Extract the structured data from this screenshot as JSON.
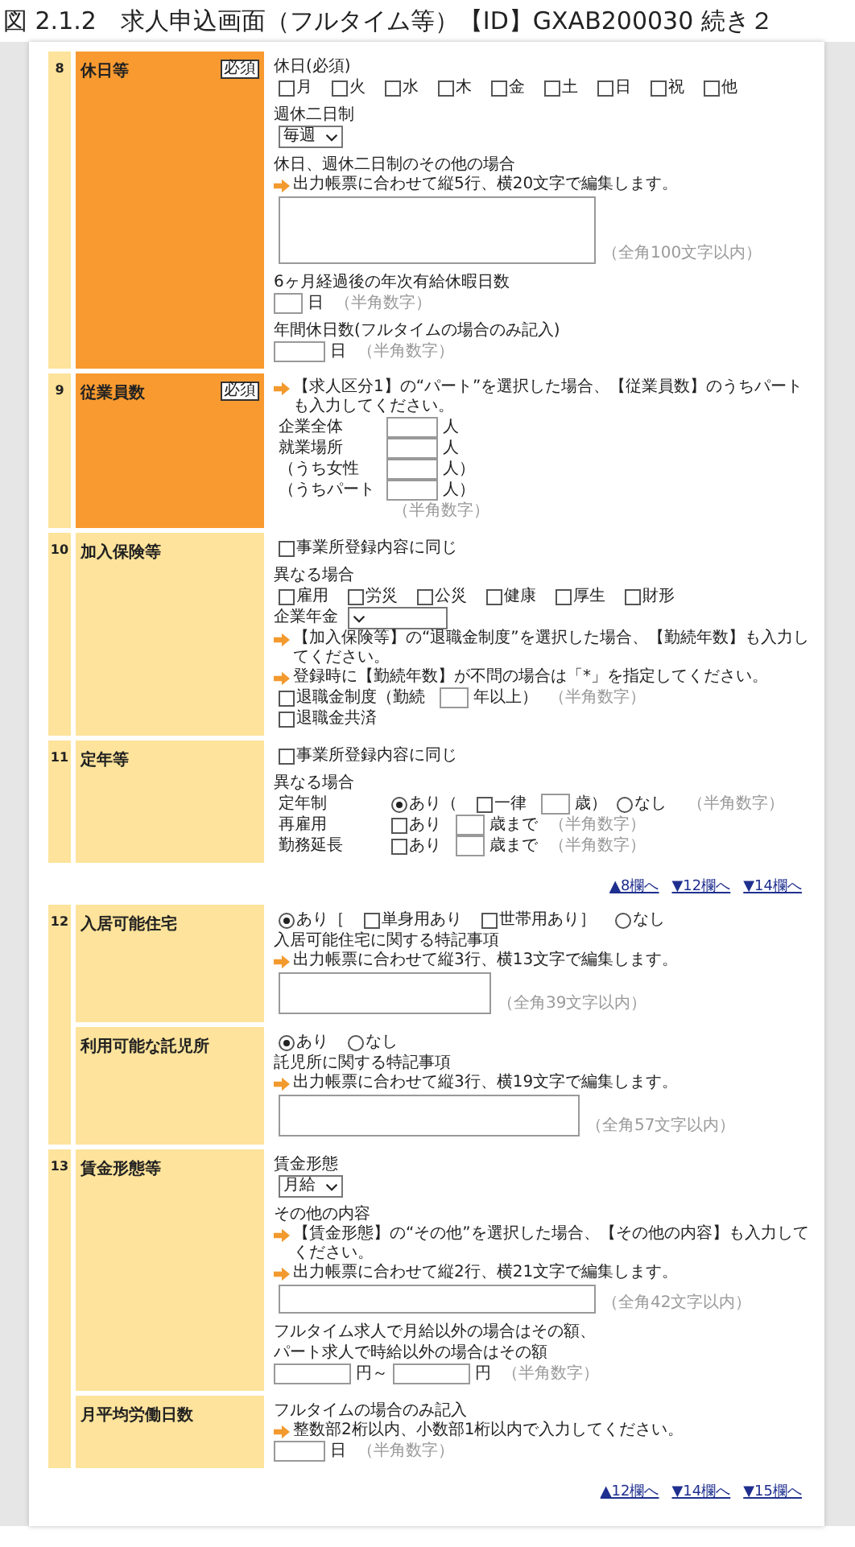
{
  "title": "図 2.1.2　求人申込画面（フルタイム等）【ID】GXAB200030 続き２",
  "blocks": [
    {
      "kind": "section",
      "number": "8",
      "rows": [
        {
          "label": "休日等",
          "required": true,
          "badge": "必須",
          "lines": [
            {
              "kind": "line",
              "parts": [
                {
                  "kind": "text",
                  "text": "休日(必須)"
                }
              ]
            },
            {
              "kind": "line",
              "parts": [
                {
                  "kind": "check",
                  "label": "月",
                  "checked": false
                },
                {
                  "kind": "check",
                  "label": "火",
                  "checked": false
                },
                {
                  "kind": "check",
                  "label": "水",
                  "checked": false
                },
                {
                  "kind": "check",
                  "label": "木",
                  "checked": false
                },
                {
                  "kind": "check",
                  "label": "金",
                  "checked": false
                },
                {
                  "kind": "check",
                  "label": "土",
                  "checked": false
                },
                {
                  "kind": "check",
                  "label": "日",
                  "checked": false
                },
                {
                  "kind": "check",
                  "label": "祝",
                  "checked": false
                },
                {
                  "kind": "check",
                  "label": "他",
                  "checked": false
                }
              ]
            },
            {
              "kind": "gap"
            },
            {
              "kind": "line",
              "parts": [
                {
                  "kind": "text",
                  "text": "週休二日制"
                }
              ]
            },
            {
              "kind": "line",
              "parts": [
                {
                  "kind": "select",
                  "value": "毎週"
                }
              ]
            },
            {
              "kind": "gap"
            },
            {
              "kind": "line",
              "parts": [
                {
                  "kind": "text",
                  "text": "休日、週休二日制のその他の場合"
                }
              ]
            },
            {
              "kind": "note",
              "text": "出力帳票に合わせて縦5行、横20文字で編集します。"
            },
            {
              "kind": "tall-textarea",
              "hint": "（全角100文字以内）"
            },
            {
              "kind": "gap"
            },
            {
              "kind": "line",
              "parts": [
                {
                  "kind": "text",
                  "text": "6ヶ月経過後の年次有給休暇日数"
                }
              ]
            },
            {
              "kind": "line",
              "parts": [
                {
                  "kind": "short-input"
                },
                {
                  "kind": "text",
                  "text": "日"
                },
                {
                  "kind": "hint",
                  "text": "（半角数字）"
                }
              ]
            },
            {
              "kind": "gap"
            },
            {
              "kind": "line",
              "parts": [
                {
                  "kind": "text",
                  "text": "年間休日数(フルタイムの場合のみ記入)"
                }
              ]
            },
            {
              "kind": "line",
              "parts": [
                {
                  "kind": "input"
                },
                {
                  "kind": "text",
                  "text": "日"
                },
                {
                  "kind": "hint",
                  "text": "（半角数字）"
                }
              ]
            }
          ]
        }
      ]
    },
    {
      "kind": "section",
      "number": "9",
      "rows": [
        {
          "label": "従業員数",
          "required": true,
          "badge": "必須",
          "lines": [
            {
              "kind": "note",
              "text": "【求人区分1】の“パート”を選択した場合、【従業員数】のうちパートも入力してください。"
            },
            {
              "kind": "line",
              "parts": [
                {
                  "kind": "label",
                  "text": "企業全体"
                },
                {
                  "kind": "input"
                },
                {
                  "kind": "text",
                  "text": "人"
                }
              ]
            },
            {
              "kind": "line",
              "parts": [
                {
                  "kind": "label",
                  "text": "就業場所"
                },
                {
                  "kind": "input"
                },
                {
                  "kind": "text",
                  "text": "人"
                }
              ]
            },
            {
              "kind": "line",
              "parts": [
                {
                  "kind": "label",
                  "text": "（うち女性"
                },
                {
                  "kind": "input"
                },
                {
                  "kind": "text",
                  "text": "人）"
                }
              ]
            },
            {
              "kind": "line",
              "parts": [
                {
                  "kind": "label",
                  "text": "（うちパート"
                },
                {
                  "kind": "input"
                },
                {
                  "kind": "text",
                  "text": "人）"
                }
              ]
            },
            {
              "kind": "line",
              "parts": [
                {
                  "kind": "label"
                },
                {
                  "kind": "hint",
                  "text": "（半角数字）"
                }
              ]
            }
          ]
        }
      ]
    },
    {
      "kind": "section",
      "number": "10",
      "rows": [
        {
          "label": "加入保険等",
          "required": false,
          "lines": [
            {
              "kind": "line",
              "parts": [
                {
                  "kind": "check",
                  "label": "事業所登録内容に同じ",
                  "checked": false
                }
              ]
            },
            {
              "kind": "gap"
            },
            {
              "kind": "line",
              "parts": [
                {
                  "kind": "text",
                  "text": "異なる場合"
                }
              ]
            },
            {
              "kind": "line",
              "parts": [
                {
                  "kind": "check",
                  "label": "雇用",
                  "checked": false
                },
                {
                  "kind": "check",
                  "label": "労災",
                  "checked": false
                },
                {
                  "kind": "check",
                  "label": "公災",
                  "checked": false
                },
                {
                  "kind": "check",
                  "label": "健康",
                  "checked": false
                },
                {
                  "kind": "check",
                  "label": "厚生",
                  "checked": false
                },
                {
                  "kind": "check",
                  "label": "財形",
                  "checked": false
                }
              ]
            },
            {
              "kind": "line",
              "parts": [
                {
                  "kind": "text",
                  "text": "企業年金"
                },
                {
                  "kind": "wide-select"
                }
              ]
            },
            {
              "kind": "note",
              "text": "【加入保険等】の“退職金制度”を選択した場合、【勤続年数】も入力してください。"
            },
            {
              "kind": "note",
              "text": "登録時に【勤続年数】が不問の場合は「*」を指定してください。"
            },
            {
              "kind": "line",
              "parts": [
                {
                  "kind": "check",
                  "label": "退職金制度（勤続",
                  "checked": false
                },
                {
                  "kind": "short-input"
                },
                {
                  "kind": "text",
                  "text": "年以上）"
                },
                {
                  "kind": "hint",
                  "text": "（半角数字）"
                }
              ]
            },
            {
              "kind": "line",
              "parts": [
                {
                  "kind": "check",
                  "label": "退職金共済",
                  "checked": false
                }
              ]
            }
          ]
        }
      ]
    },
    {
      "kind": "section",
      "number": "11",
      "rows": [
        {
          "label": "定年等",
          "required": false,
          "lines": [
            {
              "kind": "line",
              "parts": [
                {
                  "kind": "check",
                  "label": "事業所登録内容に同じ",
                  "checked": false
                }
              ]
            },
            {
              "kind": "gap"
            },
            {
              "kind": "line",
              "parts": [
                {
                  "kind": "text",
                  "text": "異なる場合"
                }
              ]
            },
            {
              "kind": "line",
              "parts": [
                {
                  "kind": "label",
                  "text": "定年制"
                },
                {
                  "kind": "radio",
                  "label": "あり（",
                  "selected": true
                },
                {
                  "kind": "check",
                  "label": "一律",
                  "checked": false
                },
                {
                  "kind": "short-input"
                },
                {
                  "kind": "text",
                  "text": "歳）"
                },
                {
                  "kind": "radio",
                  "label": "なし",
                  "selected": false
                },
                {
                  "kind": "hint",
                  "text": "（半角数字）"
                }
              ]
            },
            {
              "kind": "line",
              "parts": [
                {
                  "kind": "label",
                  "text": "再雇用"
                },
                {
                  "kind": "check",
                  "label": "あり",
                  "checked": false
                },
                {
                  "kind": "short-input"
                },
                {
                  "kind": "text",
                  "text": "歳まで"
                },
                {
                  "kind": "hint",
                  "text": "（半角数字）"
                }
              ]
            },
            {
              "kind": "line",
              "parts": [
                {
                  "kind": "label",
                  "text": "勤務延長"
                },
                {
                  "kind": "check",
                  "label": "あり",
                  "checked": false
                },
                {
                  "kind": "short-input"
                },
                {
                  "kind": "text",
                  "text": "歳まで"
                },
                {
                  "kind": "hint",
                  "text": "（半角数字）"
                }
              ]
            }
          ]
        }
      ]
    },
    {
      "kind": "nav",
      "links": [
        "▲8欄へ",
        "▼12欄へ",
        "▼14欄へ"
      ]
    },
    {
      "kind": "section",
      "number": "12",
      "rows": [
        {
          "label": "入居可能住宅",
          "required": false,
          "lines": [
            {
              "kind": "line",
              "parts": [
                {
                  "kind": "radio",
                  "label": "あり［",
                  "selected": true
                },
                {
                  "kind": "check",
                  "label": "単身用あり",
                  "checked": false
                },
                {
                  "kind": "check",
                  "label": "世帯用あり］",
                  "checked": false
                },
                {
                  "kind": "radio",
                  "label": "なし",
                  "selected": false
                }
              ]
            },
            {
              "kind": "line",
              "parts": [
                {
                  "kind": "text",
                  "text": "入居可能住宅に関する特記事項"
                }
              ]
            },
            {
              "kind": "note",
              "text": "出力帳票に合わせて縦3行、横13文字で編集します。"
            },
            {
              "kind": "narrow-textarea",
              "hint": "（全角39文字以内）"
            }
          ]
        },
        {
          "label": "利用可能な託児所",
          "required": false,
          "lines": [
            {
              "kind": "line",
              "parts": [
                {
                  "kind": "radio",
                  "label": "あり",
                  "selected": true
                },
                {
                  "kind": "radio",
                  "label": "なし",
                  "selected": false
                }
              ]
            },
            {
              "kind": "line",
              "parts": [
                {
                  "kind": "text",
                  "text": "託児所に関する特記事項"
                }
              ]
            },
            {
              "kind": "note",
              "text": "出力帳票に合わせて縦3行、横19文字で編集します。"
            },
            {
              "kind": "medium-textarea",
              "hint": "（全角57文字以内）"
            }
          ]
        }
      ]
    },
    {
      "kind": "section",
      "number": "13",
      "rows": [
        {
          "label": "賃金形態等",
          "required": false,
          "lines": [
            {
              "kind": "line",
              "parts": [
                {
                  "kind": "text",
                  "text": "賃金形態"
                }
              ]
            },
            {
              "kind": "line",
              "parts": [
                {
                  "kind": "select",
                  "value": "月給"
                }
              ]
            },
            {
              "kind": "gap"
            },
            {
              "kind": "line",
              "parts": [
                {
                  "kind": "text",
                  "text": "その他の内容"
                }
              ]
            },
            {
              "kind": "note",
              "text": "【賃金形態】の“その他”を選択した場合、【その他の内容】も入力してください。"
            },
            {
              "kind": "note",
              "text": "出力帳票に合わせて縦2行、横21文字で編集します。"
            },
            {
              "kind": "flat-textarea",
              "hint": "（全角42文字以内）"
            },
            {
              "kind": "gap"
            },
            {
              "kind": "line",
              "parts": [
                {
                  "kind": "text",
                  "text": "フルタイム求人で月給以外の場合はその額、"
                }
              ]
            },
            {
              "kind": "line",
              "parts": [
                {
                  "kind": "text",
                  "text": "パート求人で時給以外の場合はその額"
                }
              ]
            },
            {
              "kind": "line",
              "parts": [
                {
                  "kind": "long-input"
                },
                {
                  "kind": "text",
                  "text": "円～"
                },
                {
                  "kind": "long-input"
                },
                {
                  "kind": "text",
                  "text": "円"
                },
                {
                  "kind": "hint",
                  "text": "（半角数字）"
                }
              ]
            }
          ]
        },
        {
          "label": "月平均労働日数",
          "required": false,
          "lines": [
            {
              "kind": "line",
              "parts": [
                {
                  "kind": "text",
                  "text": "フルタイムの場合のみ記入"
                }
              ]
            },
            {
              "kind": "note",
              "text": "整数部2桁以内、小数部1桁以内で入力してください。"
            },
            {
              "kind": "line",
              "parts": [
                {
                  "kind": "input"
                },
                {
                  "kind": "text",
                  "text": "日"
                },
                {
                  "kind": "hint",
                  "text": "（半角数字）"
                }
              ]
            }
          ]
        }
      ]
    },
    {
      "kind": "nav",
      "links": [
        "▲12欄へ",
        "▼14欄へ",
        "▼15欄へ"
      ]
    }
  ]
}
